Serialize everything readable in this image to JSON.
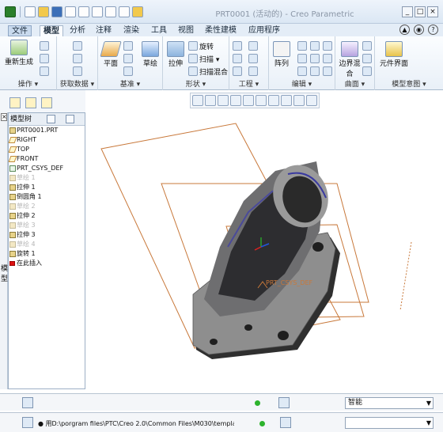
{
  "window": {
    "title": "PRT0001 (活动的) - Creo Parametric"
  },
  "tabs": [
    {
      "label": "文件"
    },
    {
      "label": "模型"
    },
    {
      "label": "分析"
    },
    {
      "label": "注释"
    },
    {
      "label": "渲染"
    },
    {
      "label": "工具"
    },
    {
      "label": "视图"
    },
    {
      "label": "柔性建模"
    },
    {
      "label": "应用程序"
    }
  ],
  "ribbon": {
    "groups": [
      {
        "label": "操作 ▾"
      },
      {
        "label": "获取数据 ▾"
      },
      {
        "label": "基准 ▾"
      },
      {
        "label": "形状 ▾"
      },
      {
        "label": "工程 ▾"
      },
      {
        "label": "编辑 ▾"
      },
      {
        "label": "曲面 ▾"
      },
      {
        "label": "模型意图 ▾"
      }
    ],
    "buttons": {
      "regenerate": "重新生成",
      "plane": "平面",
      "sketch": "草绘",
      "extrude": "拉伸",
      "revolve": "旋转",
      "sweep": "扫描 ▾",
      "swept_blend": "扫描混合",
      "pattern": "阵列",
      "boundary_blend": "边界混合",
      "component_interface": "元件界面"
    }
  },
  "tree": {
    "header": "模型树",
    "items": [
      {
        "label": "PRT0001.PRT",
        "type": "part",
        "dim": false
      },
      {
        "label": "RIGHT",
        "type": "plane",
        "dim": false
      },
      {
        "label": "TOP",
        "type": "plane",
        "dim": false
      },
      {
        "label": "FRONT",
        "type": "plane",
        "dim": false
      },
      {
        "label": "PRT_CSYS_DEF",
        "type": "csys",
        "dim": false
      },
      {
        "label": "草绘 1",
        "type": "sketch",
        "dim": true
      },
      {
        "label": "拉伸 1",
        "type": "feature",
        "dim": false
      },
      {
        "label": "倒圆角 1",
        "type": "feature",
        "dim": false
      },
      {
        "label": "草绘 2",
        "type": "sketch",
        "dim": true
      },
      {
        "label": "拉伸 2",
        "type": "feature",
        "dim": false
      },
      {
        "label": "草绘 3",
        "type": "sketch",
        "dim": true
      },
      {
        "label": "拉伸 3",
        "type": "feature",
        "dim": false
      },
      {
        "label": "草绘 4",
        "type": "sketch",
        "dim": true
      },
      {
        "label": "旋转 1",
        "type": "feature",
        "dim": false
      },
      {
        "label": "在此插入",
        "type": "insert",
        "dim": false
      }
    ]
  },
  "sidebar": {
    "label": "模型"
  },
  "viewport": {
    "csys_label": "PRT_CSYS_DEF"
  },
  "status": {
    "filter_value": "智能",
    "message": "● 用D:\\porgram files\\PTC\\Creo 2.0\\Common Files\\M030\\templates\\"
  }
}
